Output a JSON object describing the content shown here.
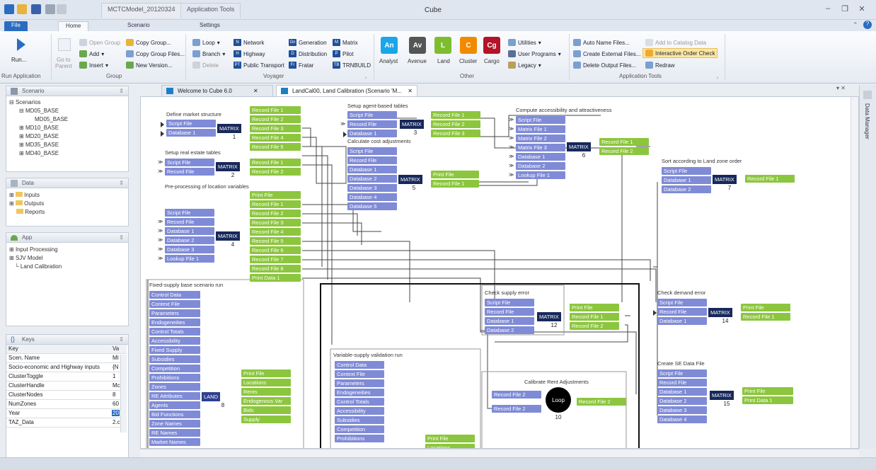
{
  "window": {
    "title": "Cube",
    "catalog_tab": "MCTCModel_20120324",
    "context_tab": "Application Tools"
  },
  "ribbon_tabs": [
    "File",
    "Home",
    "Scenario",
    "Settings"
  ],
  "ribbon": {
    "run": {
      "label": "Run...",
      "group": "Run Application"
    },
    "goto_parent": "Go to\nParent",
    "group": {
      "items": [
        "Open Group",
        "Add",
        "Insert",
        "Copy Group...",
        "Copy Group Files...",
        "New Version..."
      ],
      "label": "Group"
    },
    "voyager": {
      "items": [
        "Loop",
        "Branch",
        "Delete",
        "Network",
        "Highway",
        "Public Transport",
        "Generation",
        "Distribution",
        "Fratar",
        "Matrix",
        "Pilot",
        "TRNBUILD"
      ],
      "icon_letters": [
        "N",
        "H",
        "PT",
        "Gn",
        "D",
        "Fr",
        "M",
        "P",
        "TB"
      ],
      "label": "Voyager"
    },
    "other": {
      "apps": [
        {
          "abbr": "An",
          "label": "Analyst",
          "color": "#1aa6e8"
        },
        {
          "abbr": "Av",
          "label": "Avenue",
          "color": "#555555"
        },
        {
          "abbr": "L",
          "label": "Land",
          "color": "#7dbd2e"
        },
        {
          "abbr": "C",
          "label": "Cluster",
          "color": "#f08a00"
        },
        {
          "abbr": "Cg",
          "label": "Cargo",
          "color": "#b4142a"
        }
      ],
      "items": [
        "Utilities",
        "User Programs",
        "Legacy"
      ],
      "label": "Other"
    },
    "app_tools": {
      "items": [
        "Auto Name Files...",
        "Create External Files...",
        "Delete Output Files...",
        "Add to Catalog Data",
        "Interactive Order Check",
        "Redraw"
      ],
      "label": "Application Tools"
    }
  },
  "panels": {
    "scenario": {
      "title": "Scenario",
      "tree": [
        "Scenarios",
        "MD05_BASE",
        "MD05_BASE",
        "MD10_BASE",
        "MD20_BASE",
        "MD35_BASE",
        "MD40_BASE"
      ]
    },
    "data": {
      "title": "Data",
      "tree": [
        "Inputs",
        "Outputs",
        "Reports"
      ]
    },
    "app": {
      "title": "App",
      "tree": [
        "Input Processing",
        "SJV Model",
        "Land Calibration"
      ]
    },
    "keys": {
      "title": "Keys",
      "header": [
        "Key",
        "Va"
      ],
      "rows": [
        [
          "Scen. Name",
          "MI"
        ],
        [
          "Socio-economic and Highway inputs",
          "{N"
        ],
        [
          "ClusterToggle",
          "1"
        ],
        [
          "ClusterHandle",
          "Mc"
        ],
        [
          "ClusterNodes",
          "8"
        ],
        [
          "NumZones",
          "60"
        ],
        [
          "Year",
          "20"
        ],
        [
          "TAZ_Data",
          "2.c"
        ]
      ]
    }
  },
  "doc_tabs": [
    "Welcome to Cube 6.0",
    "LandCal00, Land Calibration (Scenario 'M..."
  ],
  "right_panel": "Data Manager",
  "flow": {
    "titles": {
      "market": "Define market structure",
      "realestate": "Setup real estate tables",
      "preproc": "Pre-processing of location variables",
      "agent": "Setup agent-based tables",
      "costadj": "Calculate cost adjustments",
      "access": "Compute accessibility and attractiveness",
      "sort": "Sort according to Land zone order",
      "fixed": "Fixed-supply base scenario run",
      "supplyerr": "Check supply error",
      "demanderr": "Check demand error",
      "variable": "Variable-supply validation run",
      "calibrent": "Calibrate Rent Adjustments",
      "sedata": "Create SE Data File"
    },
    "nodes": {
      "script_file": "Script File",
      "database_1": "Database 1",
      "database_2": "Database 2",
      "database_3": "Database 3",
      "database_4": "Database 4",
      "database_5": "Database 5",
      "record_file": "Record File",
      "record_file_1": "Record File 1",
      "record_file_2": "Record File 2",
      "record_file_3": "Record File 3",
      "record_file_4": "Record File 4",
      "record_file_5": "Record File 5",
      "record_file_6": "Record File 6",
      "record_file_7": "Record File 7",
      "record_file_8": "Record File 8",
      "print_file": "Print File",
      "print_data_1": "Print Data 1",
      "matrix_file_1": "Matrix File 1",
      "matrix_file_2": "Matrix File 2",
      "matrix_file_3": "Matrix File 3",
      "lookup_file_1": "Lookup File 1",
      "control_data": "Control Data",
      "context_file": "Context File",
      "parameters": "Parameters",
      "endogeneities": "Endogeneities",
      "control_totals": "Control Totals",
      "accessibility": "Accessibility",
      "fixed_supply": "Fixed Supply",
      "subsidies": "Subsidies",
      "competition": "Competition",
      "prohibitions": "Prohibitions",
      "zones": "Zones",
      "re_attributes": "RE Attributes",
      "agents": "Agents",
      "bid_functions": "Bid Functions",
      "zone_names": "Zone Names",
      "re_names": "RE Names",
      "market_names": "Market Names",
      "locations": "Locations",
      "rents": "Rents",
      "endogenous_var": "Endogenous Var",
      "bids": "Bids",
      "supply": "Supply"
    },
    "modules": {
      "matrix": "MATRIX",
      "land": "LAND",
      "loop": "Loop"
    },
    "numbers": [
      "1",
      "2",
      "4",
      "3",
      "5",
      "6",
      "7",
      "8",
      "12",
      "14",
      "10",
      "15"
    ]
  }
}
